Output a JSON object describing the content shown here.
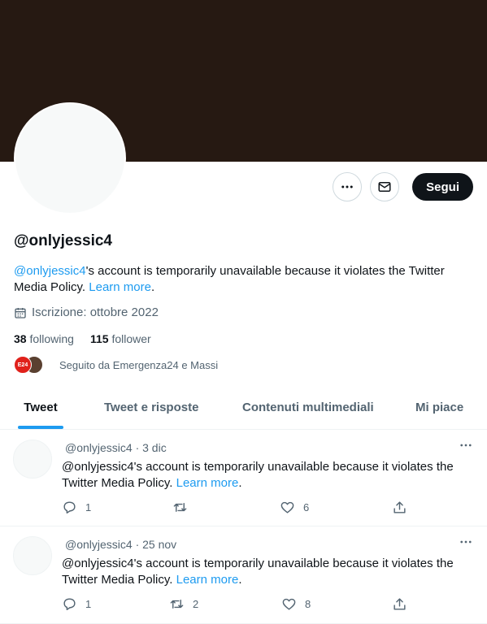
{
  "profile": {
    "handle": "@onlyjessic4",
    "bio_mention": "@onlyjessic4",
    "bio_text": "'s account is temporarily unavailable because it violates the Twitter Media Policy. ",
    "bio_link": "Learn more",
    "bio_end": ".",
    "joined": "Iscrizione: ottobre 2022",
    "following_count": "38",
    "following_label": "following",
    "followers_count": "115",
    "followers_label": "follower",
    "followed_by": "Seguito da Emergenza24 e Massi",
    "mini_avatar_label": "E24"
  },
  "actions": {
    "follow_label": "Segui"
  },
  "tabs": [
    {
      "label": "Tweet"
    },
    {
      "label": "Tweet e risposte"
    },
    {
      "label": "Contenuti multimediali"
    },
    {
      "label": "Mi piace"
    }
  ],
  "tweets": [
    {
      "meta": "@onlyjessic4 · 3 dic",
      "text": "@onlyjessic4's account is temporarily unavailable because it violates the Twitter Media Policy. ",
      "link": "Learn more",
      "end": ".",
      "replies": "1",
      "retweets": "",
      "likes": "6"
    },
    {
      "meta": "@onlyjessic4 · 25 nov",
      "text": "@onlyjessic4's account is temporarily unavailable because it violates the Twitter Media Policy. ",
      "link": "Learn more",
      "end": ".",
      "replies": "1",
      "retweets": "2",
      "likes": "8"
    }
  ],
  "colors": {
    "accent": "#1d9bf0",
    "banner": "#261912",
    "follow_button": "#0f1419",
    "muted_text": "#536471"
  }
}
